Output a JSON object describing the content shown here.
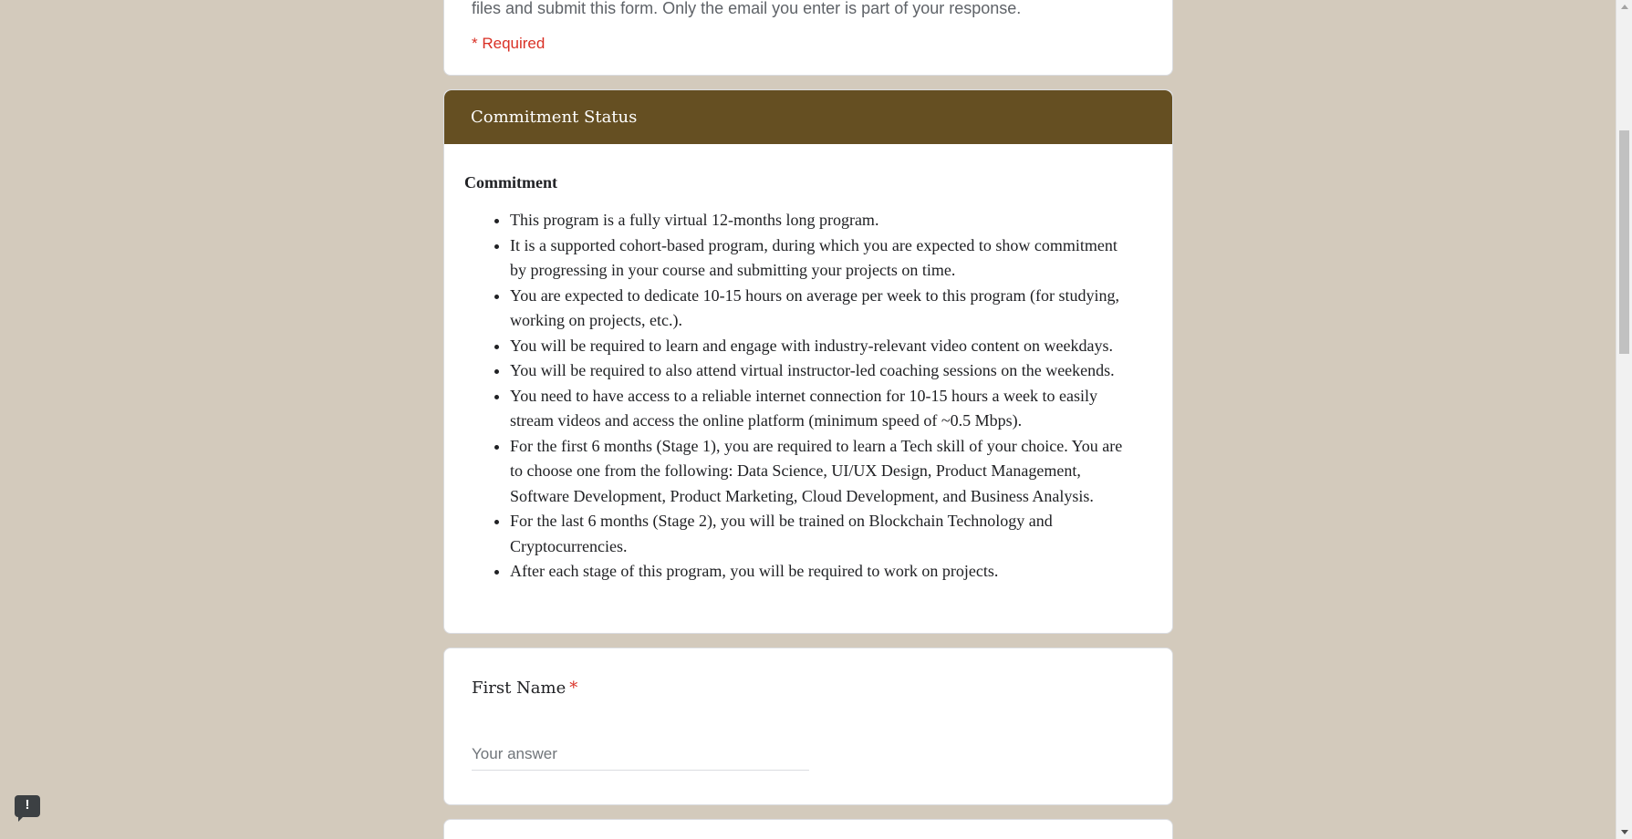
{
  "intro": {
    "description_fragment": "files and submit this form. Only the email you enter is part of your response.",
    "required_note": "* Required"
  },
  "section": {
    "header_title": "Commitment Status",
    "title": "Commitment",
    "items": [
      "This program is a fully virtual 12-months long program.",
      "It is a supported cohort-based program, during which you are expected to show commitment by progressing in your course and submitting your projects on time.",
      "You are expected to dedicate 10-15 hours on average per week to this program (for studying, working on projects, etc.).",
      "You will be required to learn and engage with industry-relevant video content on weekdays.",
      "You will be required to also attend virtual instructor-led coaching sessions on the weekends.",
      "You need to have access to a reliable internet connection for 10-15 hours a week to easily stream videos and access the online platform (minimum speed of ~0.5 Mbps).",
      "For the first 6 months (Stage 1), you are required to learn a Tech skill of your choice. You are to choose one from the following: Data Science, UI/UX Design, Product Management, Software Development, Product Marketing, Cloud Development, and Business Analysis.",
      "For the last 6 months (Stage 2), you will be trained on Blockchain Technology and Cryptocurrencies.",
      "After each stage of this program, you will be required to work on projects."
    ]
  },
  "question_first_name": {
    "label": "First Name",
    "required_marker": "*",
    "placeholder": "Your answer",
    "value": ""
  },
  "feedback": {
    "icon_glyph": "!",
    "icon": "report-feedback-icon"
  },
  "colors": {
    "background": "#d3cabc",
    "header": "#654f22",
    "required": "#d93025"
  }
}
